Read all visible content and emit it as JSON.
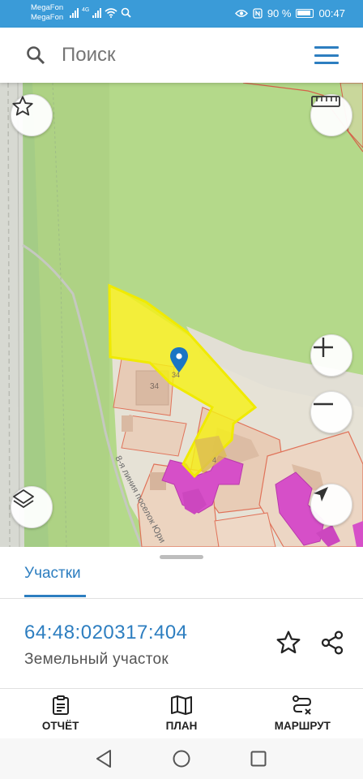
{
  "status": {
    "carrier1": "MegaFon",
    "carrier2": "MegaFon",
    "network": "4G",
    "battery": "90 %",
    "time": "00:47"
  },
  "search": {
    "placeholder": "Поиск"
  },
  "map": {
    "house_number": "34",
    "plot_number": "4",
    "street_label": "8-я линия поселок Юри"
  },
  "sheet": {
    "tab_label": "Участки",
    "cadastral_number": "64:48:020317:404",
    "object_type": "Земельный участок"
  },
  "actions": {
    "report": "ОТЧЁТ",
    "plan": "ПЛАН",
    "route": "МАРШРУТ"
  },
  "colors": {
    "accent": "#2d7ec0",
    "statusbar": "#3a9bd8",
    "selected_plot": "#f5f017",
    "building": "#d64fc8"
  }
}
